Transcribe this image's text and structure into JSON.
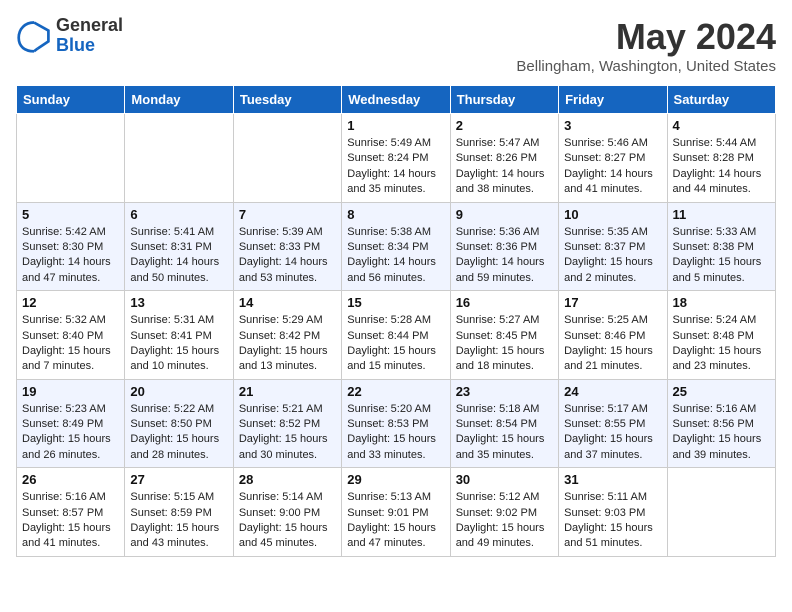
{
  "header": {
    "logo": {
      "general": "General",
      "blue": "Blue"
    },
    "month": "May 2024",
    "location": "Bellingham, Washington, United States"
  },
  "weekdays": [
    "Sunday",
    "Monday",
    "Tuesday",
    "Wednesday",
    "Thursday",
    "Friday",
    "Saturday"
  ],
  "weeks": [
    [
      {
        "day": "",
        "info": ""
      },
      {
        "day": "",
        "info": ""
      },
      {
        "day": "",
        "info": ""
      },
      {
        "day": "1",
        "info": "Sunrise: 5:49 AM\nSunset: 8:24 PM\nDaylight: 14 hours\nand 35 minutes."
      },
      {
        "day": "2",
        "info": "Sunrise: 5:47 AM\nSunset: 8:26 PM\nDaylight: 14 hours\nand 38 minutes."
      },
      {
        "day": "3",
        "info": "Sunrise: 5:46 AM\nSunset: 8:27 PM\nDaylight: 14 hours\nand 41 minutes."
      },
      {
        "day": "4",
        "info": "Sunrise: 5:44 AM\nSunset: 8:28 PM\nDaylight: 14 hours\nand 44 minutes."
      }
    ],
    [
      {
        "day": "5",
        "info": "Sunrise: 5:42 AM\nSunset: 8:30 PM\nDaylight: 14 hours\nand 47 minutes."
      },
      {
        "day": "6",
        "info": "Sunrise: 5:41 AM\nSunset: 8:31 PM\nDaylight: 14 hours\nand 50 minutes."
      },
      {
        "day": "7",
        "info": "Sunrise: 5:39 AM\nSunset: 8:33 PM\nDaylight: 14 hours\nand 53 minutes."
      },
      {
        "day": "8",
        "info": "Sunrise: 5:38 AM\nSunset: 8:34 PM\nDaylight: 14 hours\nand 56 minutes."
      },
      {
        "day": "9",
        "info": "Sunrise: 5:36 AM\nSunset: 8:36 PM\nDaylight: 14 hours\nand 59 minutes."
      },
      {
        "day": "10",
        "info": "Sunrise: 5:35 AM\nSunset: 8:37 PM\nDaylight: 15 hours\nand 2 minutes."
      },
      {
        "day": "11",
        "info": "Sunrise: 5:33 AM\nSunset: 8:38 PM\nDaylight: 15 hours\nand 5 minutes."
      }
    ],
    [
      {
        "day": "12",
        "info": "Sunrise: 5:32 AM\nSunset: 8:40 PM\nDaylight: 15 hours\nand 7 minutes."
      },
      {
        "day": "13",
        "info": "Sunrise: 5:31 AM\nSunset: 8:41 PM\nDaylight: 15 hours\nand 10 minutes."
      },
      {
        "day": "14",
        "info": "Sunrise: 5:29 AM\nSunset: 8:42 PM\nDaylight: 15 hours\nand 13 minutes."
      },
      {
        "day": "15",
        "info": "Sunrise: 5:28 AM\nSunset: 8:44 PM\nDaylight: 15 hours\nand 15 minutes."
      },
      {
        "day": "16",
        "info": "Sunrise: 5:27 AM\nSunset: 8:45 PM\nDaylight: 15 hours\nand 18 minutes."
      },
      {
        "day": "17",
        "info": "Sunrise: 5:25 AM\nSunset: 8:46 PM\nDaylight: 15 hours\nand 21 minutes."
      },
      {
        "day": "18",
        "info": "Sunrise: 5:24 AM\nSunset: 8:48 PM\nDaylight: 15 hours\nand 23 minutes."
      }
    ],
    [
      {
        "day": "19",
        "info": "Sunrise: 5:23 AM\nSunset: 8:49 PM\nDaylight: 15 hours\nand 26 minutes."
      },
      {
        "day": "20",
        "info": "Sunrise: 5:22 AM\nSunset: 8:50 PM\nDaylight: 15 hours\nand 28 minutes."
      },
      {
        "day": "21",
        "info": "Sunrise: 5:21 AM\nSunset: 8:52 PM\nDaylight: 15 hours\nand 30 minutes."
      },
      {
        "day": "22",
        "info": "Sunrise: 5:20 AM\nSunset: 8:53 PM\nDaylight: 15 hours\nand 33 minutes."
      },
      {
        "day": "23",
        "info": "Sunrise: 5:18 AM\nSunset: 8:54 PM\nDaylight: 15 hours\nand 35 minutes."
      },
      {
        "day": "24",
        "info": "Sunrise: 5:17 AM\nSunset: 8:55 PM\nDaylight: 15 hours\nand 37 minutes."
      },
      {
        "day": "25",
        "info": "Sunrise: 5:16 AM\nSunset: 8:56 PM\nDaylight: 15 hours\nand 39 minutes."
      }
    ],
    [
      {
        "day": "26",
        "info": "Sunrise: 5:16 AM\nSunset: 8:57 PM\nDaylight: 15 hours\nand 41 minutes."
      },
      {
        "day": "27",
        "info": "Sunrise: 5:15 AM\nSunset: 8:59 PM\nDaylight: 15 hours\nand 43 minutes."
      },
      {
        "day": "28",
        "info": "Sunrise: 5:14 AM\nSunset: 9:00 PM\nDaylight: 15 hours\nand 45 minutes."
      },
      {
        "day": "29",
        "info": "Sunrise: 5:13 AM\nSunset: 9:01 PM\nDaylight: 15 hours\nand 47 minutes."
      },
      {
        "day": "30",
        "info": "Sunrise: 5:12 AM\nSunset: 9:02 PM\nDaylight: 15 hours\nand 49 minutes."
      },
      {
        "day": "31",
        "info": "Sunrise: 5:11 AM\nSunset: 9:03 PM\nDaylight: 15 hours\nand 51 minutes."
      },
      {
        "day": "",
        "info": ""
      }
    ]
  ]
}
